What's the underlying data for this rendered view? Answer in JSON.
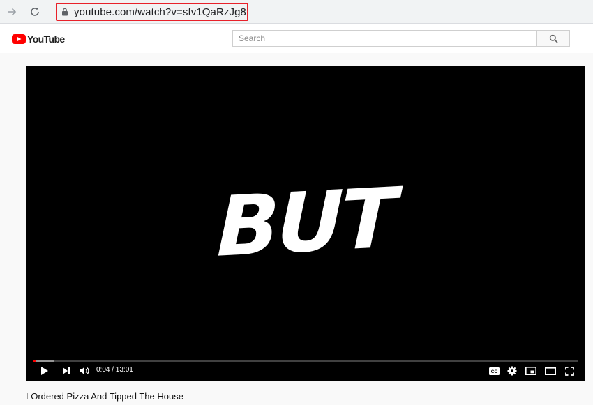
{
  "browser": {
    "address": "youtube.com/watch?v=sfv1QaRzJg8",
    "highlight_color": "#e8212a"
  },
  "header": {
    "logo_text": "YouTube",
    "search": {
      "placeholder": "Search",
      "value": ""
    },
    "brand_color": "#ff0000"
  },
  "player": {
    "overlay_text": "BUT",
    "time": {
      "current": "0:04",
      "total": "13:01",
      "display": "0:04 / 13:01"
    },
    "progress_played_fraction": 0.005,
    "progress_loaded_fraction": 0.04,
    "icons": [
      "play-icon",
      "next-icon",
      "volume-icon",
      "captions-icon",
      "settings-icon",
      "miniplayer-icon",
      "theater-icon",
      "fullscreen-icon"
    ]
  },
  "video": {
    "title": "I Ordered Pizza And Tipped The House"
  }
}
